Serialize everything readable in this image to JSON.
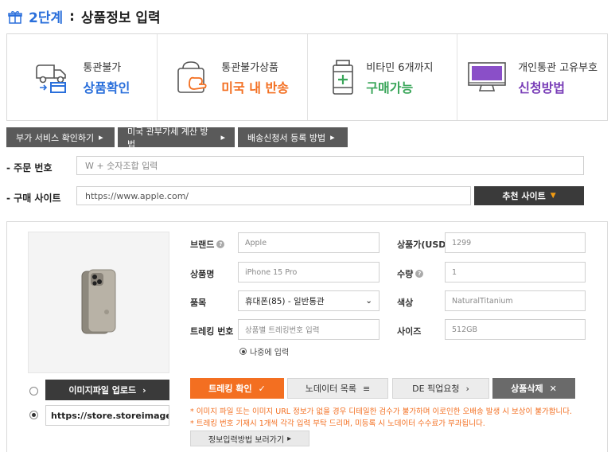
{
  "header": {
    "step_no": "2단계",
    "separator": ":",
    "title": "상품정보 입력"
  },
  "info": [
    {
      "top": "통관불가",
      "bottom": "상품확인",
      "icon": "delivery-truck-icon",
      "color": "#2a6fdb"
    },
    {
      "top": "통관불가상품",
      "bottom": "미국 내 반송",
      "icon": "return-bag-icon",
      "color": "#f36f21"
    },
    {
      "top": "비타민 6개까지",
      "bottom": "구매가능",
      "icon": "vitamin-bottle-icon",
      "color": "#3aa65a"
    },
    {
      "top": "개인통관 고유부호",
      "bottom": "신청방법",
      "icon": "monitor-icon",
      "color": "#7a3fb8"
    }
  ],
  "services": [
    {
      "label": "부가 서비스 확인하기"
    },
    {
      "label": "미국 관부가세 계산 방법"
    },
    {
      "label": "배송신청서 등록 방법"
    }
  ],
  "order": {
    "label": "- 주문 번호",
    "placeholder": "W + 숫자조합 입력"
  },
  "site": {
    "label": "- 구매 사이트",
    "value": "https://www.apple.com/",
    "recommend": "추천 사이트"
  },
  "product": {
    "upload_label": "이미지파일 업로드",
    "image_url": "https://store.storeimages.c",
    "brand": {
      "label": "브랜드",
      "value": "Apple"
    },
    "price": {
      "label": "상품가(USD)",
      "value": "1299"
    },
    "name": {
      "label": "상품명",
      "value": "iPhone 15 Pro"
    },
    "qty": {
      "label": "수량",
      "value": "1"
    },
    "category": {
      "label": "품목",
      "value": "휴대폰(85) - 일반통관"
    },
    "color": {
      "label": "색상",
      "value": "NaturalTitanium"
    },
    "tracking": {
      "label": "트레킹 번호",
      "placeholder": "상품별 트레킹번호 입력"
    },
    "size": {
      "label": "사이즈",
      "value": "512GB"
    },
    "later": "나중에 입력"
  },
  "actions": {
    "track": "트레킹 확인",
    "nodata": "노데이터 목록",
    "de_pickup": "DE 픽업요청",
    "delete": "상품삭제"
  },
  "notices": [
    "* 이미지 파일 또는 이미지 URL 정보가 없을 경우 디테일한 검수가 불가하며 이로인한 오배송 발생 시 보상이 불가합니다.",
    "* 트레킹 번호 기재시 1개씩 각각 입력 부탁 드리며, 미등록 시 노데이터 수수료가 부과됩니다."
  ],
  "guide": "정보입력방법 보러가기"
}
